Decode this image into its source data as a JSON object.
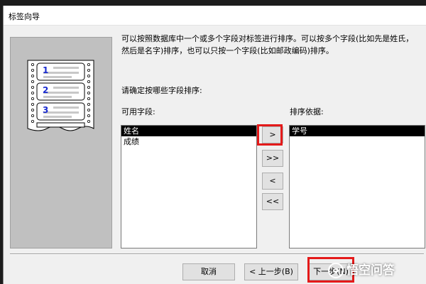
{
  "window": {
    "title": "标签向导"
  },
  "description": "可以按照数据库中一个或多个字段对标签进行排序。可以按多个字段(比如先是姓氏，然后是名字)排序，也可以只按一个字段(比如邮政编码)排序。",
  "prompt": "请确定按哪些字段排序:",
  "available": {
    "label": "可用字段:",
    "items": [
      {
        "label": "姓名",
        "selected": true
      },
      {
        "label": "成绩",
        "selected": false
      }
    ]
  },
  "sort": {
    "label": "排序依据:",
    "items": [
      {
        "label": "学号",
        "selected": true
      }
    ]
  },
  "move_buttons": {
    "add_one": ">",
    "add_all": ">>",
    "remove_one": "<",
    "remove_all": "<<"
  },
  "footer": {
    "cancel": "取消",
    "back": "< 上一步(B)",
    "next": "下一步(N)"
  },
  "illustration": {
    "labels": [
      "1",
      "2",
      "3"
    ]
  },
  "watermark": {
    "text": "悟空问答"
  },
  "colors": {
    "highlight": "#e41a1a",
    "selection": "#000000",
    "dialog_bg": "#f0f0f0"
  }
}
